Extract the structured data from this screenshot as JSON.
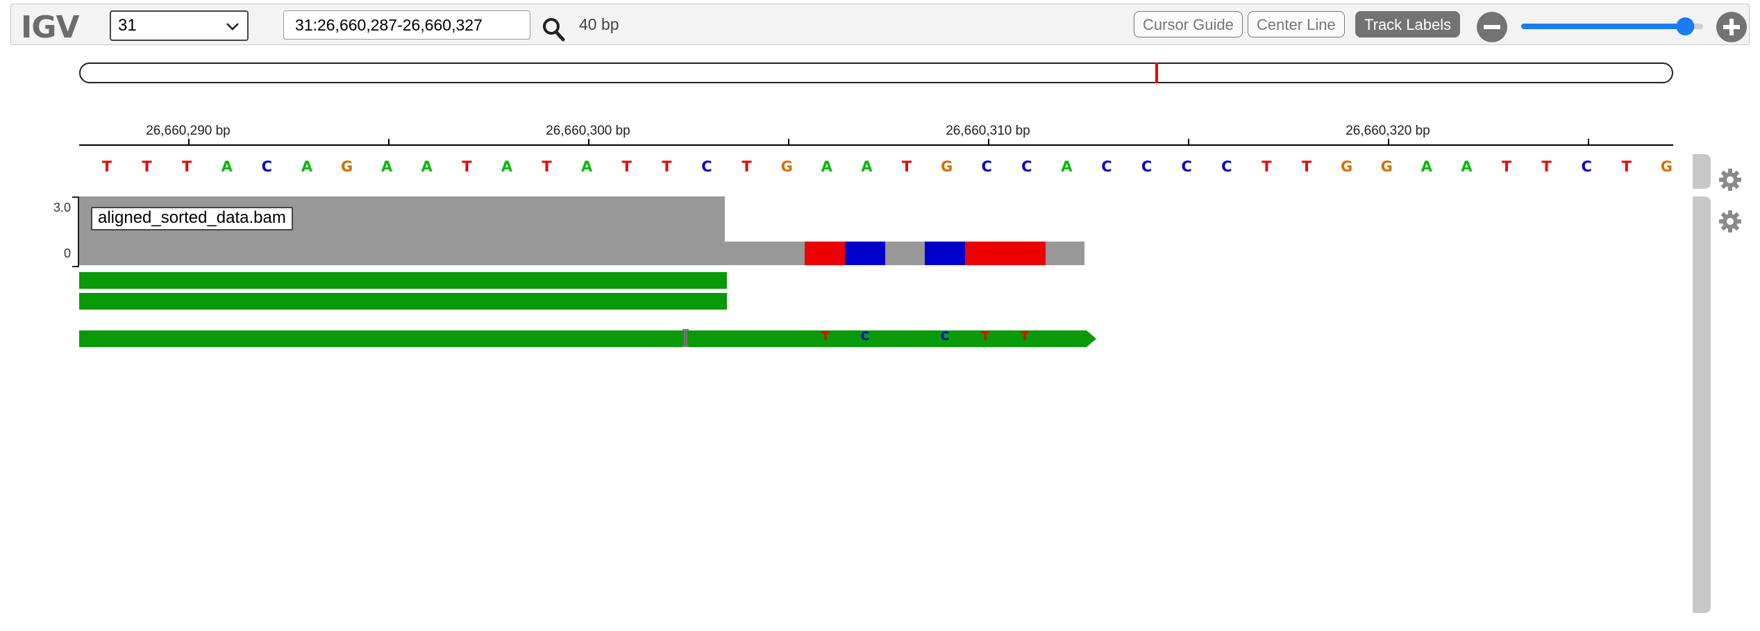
{
  "app": {
    "logo": "IGV"
  },
  "navbar": {
    "chromosome": "31",
    "locus": "31:26,660,287-26,660,327",
    "width_label": "40 bp",
    "buttons": {
      "cursor_guide": "Cursor Guide",
      "center_line": "Center Line",
      "track_labels": "Track Labels"
    },
    "zoom_level": 0.95
  },
  "ruler": {
    "ticks": [
      {
        "label": "26,660,290 bp",
        "major": true
      },
      {
        "label": "",
        "major": false
      },
      {
        "label": "26,660,300 bp",
        "major": true
      },
      {
        "label": "",
        "major": false
      },
      {
        "label": "26,660,310 bp",
        "major": true
      },
      {
        "label": "",
        "major": false
      },
      {
        "label": "26,660,320 bp",
        "major": true
      },
      {
        "label": "",
        "major": false
      }
    ]
  },
  "sequence": [
    "T",
    "T",
    "T",
    "A",
    "C",
    "A",
    "G",
    "A",
    "A",
    "T",
    "A",
    "T",
    "A",
    "T",
    "T",
    "C",
    "T",
    "G",
    "A",
    "A",
    "T",
    "G",
    "C",
    "C",
    "A",
    "C",
    "C",
    "C",
    "C",
    "T",
    "T",
    "G",
    "G",
    "A",
    "A",
    "T",
    "T",
    "C",
    "T",
    "G"
  ],
  "base_colors": {
    "A": "#00bb00",
    "C": "#0000cc",
    "G": "#d17105",
    "T": "#ee0000"
  },
  "track": {
    "name": "aligned_sorted_data.bam",
    "scale_max": "3.0",
    "scale_min": "0",
    "mismatch_bases": [
      "T",
      "C",
      "C",
      "T",
      "T"
    ]
  },
  "colors": {
    "read": "#089a08",
    "coverage": "#989898",
    "accent": "#1a7cf0"
  }
}
